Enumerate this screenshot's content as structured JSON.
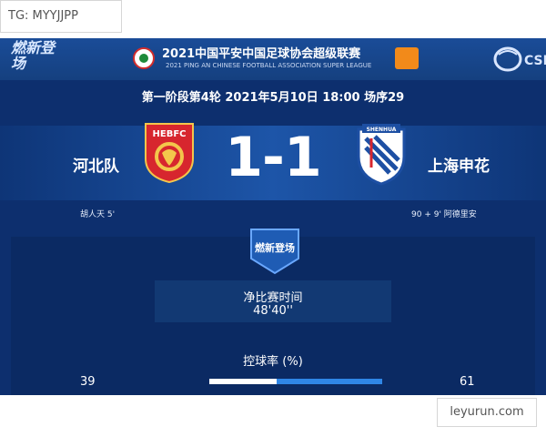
{
  "header": {
    "logo_text": "燃新登场",
    "league_cn": "2021中国平安中国足球协会超级联赛",
    "league_en": "2021 PING AN CHINESE FOOTBALL ASSOCIATION SUPER LEAGUE",
    "right_logo_text": "CSL"
  },
  "match": {
    "info": "第一阶段第4轮  2021年5月10日 18:00 场序29",
    "home_team": "河北队",
    "away_team": "上海申花",
    "home_crest_text": "HEBFC",
    "away_crest_text": "SHENHUA",
    "score": "1-1",
    "home_scorer": "胡人天  5'",
    "away_scorer": "90 + 9'  阿德里安"
  },
  "stats": {
    "badge_text": "燃新登场",
    "net_time_label": "净比赛时间",
    "net_time_value": "48'40''",
    "possession_label": "控球率 (%)",
    "possession_home": "39",
    "possession_away": "61",
    "possession_home_value": 39,
    "possession_away_value": 61
  },
  "watermarks": {
    "top_left": "TG: MYYJJPP",
    "bottom_right": "leyurun.com"
  },
  "colors": {
    "background": "#0d2f6e",
    "home_crest": "#d7262e",
    "away_crest_blue": "#1d4fa3",
    "possession_home": "#ffffff",
    "possession_away": "#2f86e6"
  }
}
